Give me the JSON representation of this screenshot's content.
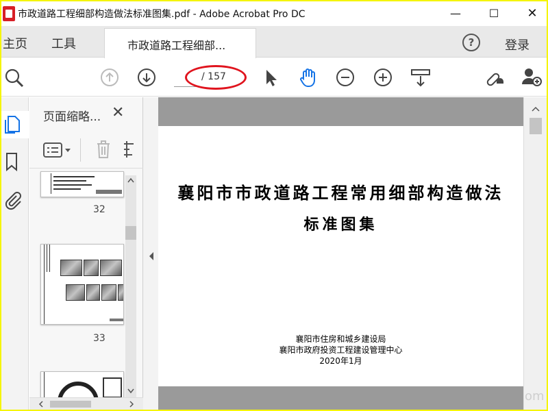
{
  "window": {
    "title": "市政道路工程细部构造做法标准图集.pdf - Adobe Acrobat Pro DC",
    "minimize": "—",
    "maximize": "☐",
    "close": "✕"
  },
  "tabs": {
    "home": "主页",
    "tools": "工具",
    "document": "市政道路工程细部...",
    "help": "?",
    "signin": "登录"
  },
  "toolbar": {
    "page_current": "",
    "page_total": "/ 157",
    "annotation_color": "#e0141e",
    "icons": [
      "search-zoom-icon",
      "prev-page-icon",
      "next-page-icon",
      "select-arrow-icon",
      "hand-tool-icon",
      "zoom-out-icon",
      "zoom-in-icon",
      "fit-page-icon",
      "share-link-icon",
      "add-user-icon"
    ]
  },
  "panel": {
    "title": "页面缩略...",
    "close": "✕",
    "thumbnails": [
      {
        "label": "32"
      },
      {
        "label": "33"
      }
    ]
  },
  "document": {
    "title_line1": "襄阳市市政道路工程常用细部构造做法",
    "title_line2": "标准图集",
    "issuer1": "襄阳市住房和城乡建设局",
    "issuer2": "襄阳市政府投资工程建设管理中心",
    "date": "2020年1月"
  },
  "colors": {
    "accent": "#1473e6",
    "frame": "#f5f500",
    "pdf_red": "#d71f26"
  }
}
